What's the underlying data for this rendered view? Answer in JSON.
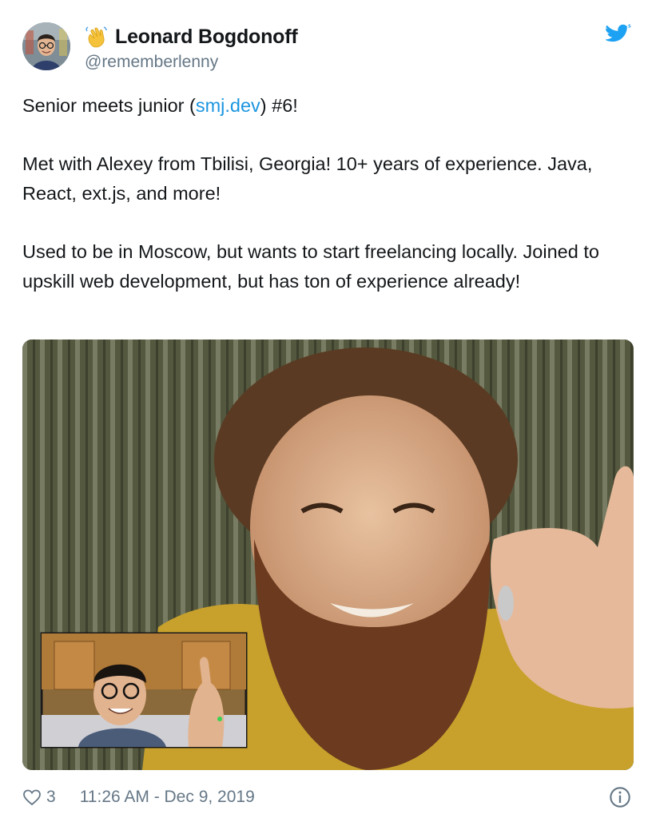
{
  "author": {
    "display_name": "Leonard Bogdonoff",
    "handle": "@rememberlenny",
    "avatar_icon": "avatar-photo",
    "emoji_icon": "waving-hand-emoji"
  },
  "brand": {
    "icon": "twitter-bird-icon",
    "color": "#1da1f2"
  },
  "tweet": {
    "line1_pre": "Senior meets junior (",
    "line1_link": "smj.dev",
    "line1_post": ") #6!",
    "paragraph2": "Met with Alexey from Tbilisi, Georgia! 10+ years of experience. Java, React, ext.js, and more!",
    "paragraph3": "Used to be in Moscow, but wants to start freelancing locally. Joined to upskill web development, but has ton of experience already!"
  },
  "media": {
    "type": "video-call-photo",
    "main_subject": "bearded man giving thumbs up",
    "inset_subject": "man with glasses giving thumbs up"
  },
  "footer": {
    "like_count": "3",
    "timestamp": "11:26 AM - Dec 9, 2019",
    "heart_icon": "heart-icon",
    "info_icon": "info-icon"
  },
  "colors": {
    "text": "#14171a",
    "secondary": "#657786",
    "link": "#1b95e0"
  }
}
